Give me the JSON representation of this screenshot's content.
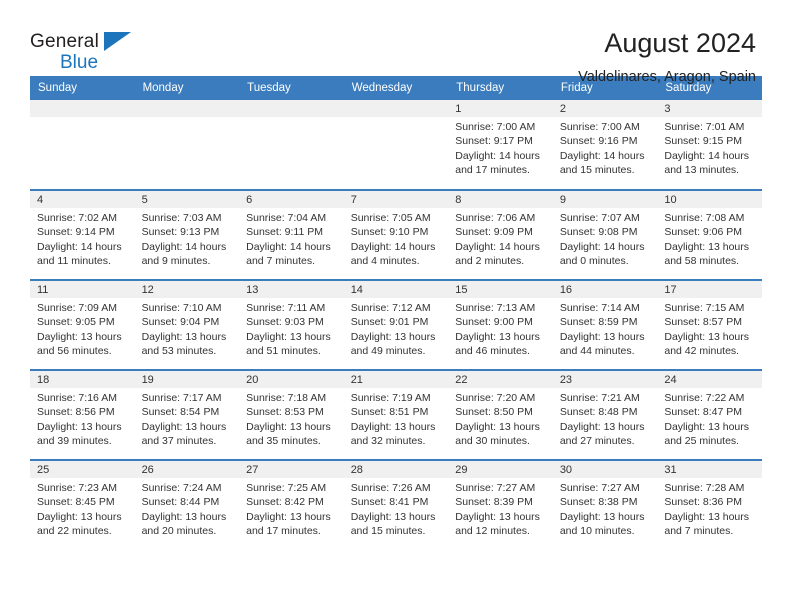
{
  "brand": {
    "name_line1": "General",
    "name_line2": "Blue",
    "accent_color": "#1c75bc"
  },
  "header": {
    "title": "August 2024",
    "location": "Valdelinares, Aragon, Spain",
    "header_bg": "#3a7cbd",
    "header_text_color": "#ffffff"
  },
  "weekday_headers": [
    "Sunday",
    "Monday",
    "Tuesday",
    "Wednesday",
    "Thursday",
    "Friday",
    "Saturday"
  ],
  "weeks": [
    [
      {
        "day": "",
        "sunrise": "",
        "sunset": "",
        "daylight_line1": "",
        "daylight_line2": ""
      },
      {
        "day": "",
        "sunrise": "",
        "sunset": "",
        "daylight_line1": "",
        "daylight_line2": ""
      },
      {
        "day": "",
        "sunrise": "",
        "sunset": "",
        "daylight_line1": "",
        "daylight_line2": ""
      },
      {
        "day": "",
        "sunrise": "",
        "sunset": "",
        "daylight_line1": "",
        "daylight_line2": ""
      },
      {
        "day": "1",
        "sunrise": "Sunrise: 7:00 AM",
        "sunset": "Sunset: 9:17 PM",
        "daylight_line1": "Daylight: 14 hours",
        "daylight_line2": "and 17 minutes."
      },
      {
        "day": "2",
        "sunrise": "Sunrise: 7:00 AM",
        "sunset": "Sunset: 9:16 PM",
        "daylight_line1": "Daylight: 14 hours",
        "daylight_line2": "and 15 minutes."
      },
      {
        "day": "3",
        "sunrise": "Sunrise: 7:01 AM",
        "sunset": "Sunset: 9:15 PM",
        "daylight_line1": "Daylight: 14 hours",
        "daylight_line2": "and 13 minutes."
      }
    ],
    [
      {
        "day": "4",
        "sunrise": "Sunrise: 7:02 AM",
        "sunset": "Sunset: 9:14 PM",
        "daylight_line1": "Daylight: 14 hours",
        "daylight_line2": "and 11 minutes."
      },
      {
        "day": "5",
        "sunrise": "Sunrise: 7:03 AM",
        "sunset": "Sunset: 9:13 PM",
        "daylight_line1": "Daylight: 14 hours",
        "daylight_line2": "and 9 minutes."
      },
      {
        "day": "6",
        "sunrise": "Sunrise: 7:04 AM",
        "sunset": "Sunset: 9:11 PM",
        "daylight_line1": "Daylight: 14 hours",
        "daylight_line2": "and 7 minutes."
      },
      {
        "day": "7",
        "sunrise": "Sunrise: 7:05 AM",
        "sunset": "Sunset: 9:10 PM",
        "daylight_line1": "Daylight: 14 hours",
        "daylight_line2": "and 4 minutes."
      },
      {
        "day": "8",
        "sunrise": "Sunrise: 7:06 AM",
        "sunset": "Sunset: 9:09 PM",
        "daylight_line1": "Daylight: 14 hours",
        "daylight_line2": "and 2 minutes."
      },
      {
        "day": "9",
        "sunrise": "Sunrise: 7:07 AM",
        "sunset": "Sunset: 9:08 PM",
        "daylight_line1": "Daylight: 14 hours",
        "daylight_line2": "and 0 minutes."
      },
      {
        "day": "10",
        "sunrise": "Sunrise: 7:08 AM",
        "sunset": "Sunset: 9:06 PM",
        "daylight_line1": "Daylight: 13 hours",
        "daylight_line2": "and 58 minutes."
      }
    ],
    [
      {
        "day": "11",
        "sunrise": "Sunrise: 7:09 AM",
        "sunset": "Sunset: 9:05 PM",
        "daylight_line1": "Daylight: 13 hours",
        "daylight_line2": "and 56 minutes."
      },
      {
        "day": "12",
        "sunrise": "Sunrise: 7:10 AM",
        "sunset": "Sunset: 9:04 PM",
        "daylight_line1": "Daylight: 13 hours",
        "daylight_line2": "and 53 minutes."
      },
      {
        "day": "13",
        "sunrise": "Sunrise: 7:11 AM",
        "sunset": "Sunset: 9:03 PM",
        "daylight_line1": "Daylight: 13 hours",
        "daylight_line2": "and 51 minutes."
      },
      {
        "day": "14",
        "sunrise": "Sunrise: 7:12 AM",
        "sunset": "Sunset: 9:01 PM",
        "daylight_line1": "Daylight: 13 hours",
        "daylight_line2": "and 49 minutes."
      },
      {
        "day": "15",
        "sunrise": "Sunrise: 7:13 AM",
        "sunset": "Sunset: 9:00 PM",
        "daylight_line1": "Daylight: 13 hours",
        "daylight_line2": "and 46 minutes."
      },
      {
        "day": "16",
        "sunrise": "Sunrise: 7:14 AM",
        "sunset": "Sunset: 8:59 PM",
        "daylight_line1": "Daylight: 13 hours",
        "daylight_line2": "and 44 minutes."
      },
      {
        "day": "17",
        "sunrise": "Sunrise: 7:15 AM",
        "sunset": "Sunset: 8:57 PM",
        "daylight_line1": "Daylight: 13 hours",
        "daylight_line2": "and 42 minutes."
      }
    ],
    [
      {
        "day": "18",
        "sunrise": "Sunrise: 7:16 AM",
        "sunset": "Sunset: 8:56 PM",
        "daylight_line1": "Daylight: 13 hours",
        "daylight_line2": "and 39 minutes."
      },
      {
        "day": "19",
        "sunrise": "Sunrise: 7:17 AM",
        "sunset": "Sunset: 8:54 PM",
        "daylight_line1": "Daylight: 13 hours",
        "daylight_line2": "and 37 minutes."
      },
      {
        "day": "20",
        "sunrise": "Sunrise: 7:18 AM",
        "sunset": "Sunset: 8:53 PM",
        "daylight_line1": "Daylight: 13 hours",
        "daylight_line2": "and 35 minutes."
      },
      {
        "day": "21",
        "sunrise": "Sunrise: 7:19 AM",
        "sunset": "Sunset: 8:51 PM",
        "daylight_line1": "Daylight: 13 hours",
        "daylight_line2": "and 32 minutes."
      },
      {
        "day": "22",
        "sunrise": "Sunrise: 7:20 AM",
        "sunset": "Sunset: 8:50 PM",
        "daylight_line1": "Daylight: 13 hours",
        "daylight_line2": "and 30 minutes."
      },
      {
        "day": "23",
        "sunrise": "Sunrise: 7:21 AM",
        "sunset": "Sunset: 8:48 PM",
        "daylight_line1": "Daylight: 13 hours",
        "daylight_line2": "and 27 minutes."
      },
      {
        "day": "24",
        "sunrise": "Sunrise: 7:22 AM",
        "sunset": "Sunset: 8:47 PM",
        "daylight_line1": "Daylight: 13 hours",
        "daylight_line2": "and 25 minutes."
      }
    ],
    [
      {
        "day": "25",
        "sunrise": "Sunrise: 7:23 AM",
        "sunset": "Sunset: 8:45 PM",
        "daylight_line1": "Daylight: 13 hours",
        "daylight_line2": "and 22 minutes."
      },
      {
        "day": "26",
        "sunrise": "Sunrise: 7:24 AM",
        "sunset": "Sunset: 8:44 PM",
        "daylight_line1": "Daylight: 13 hours",
        "daylight_line2": "and 20 minutes."
      },
      {
        "day": "27",
        "sunrise": "Sunrise: 7:25 AM",
        "sunset": "Sunset: 8:42 PM",
        "daylight_line1": "Daylight: 13 hours",
        "daylight_line2": "and 17 minutes."
      },
      {
        "day": "28",
        "sunrise": "Sunrise: 7:26 AM",
        "sunset": "Sunset: 8:41 PM",
        "daylight_line1": "Daylight: 13 hours",
        "daylight_line2": "and 15 minutes."
      },
      {
        "day": "29",
        "sunrise": "Sunrise: 7:27 AM",
        "sunset": "Sunset: 8:39 PM",
        "daylight_line1": "Daylight: 13 hours",
        "daylight_line2": "and 12 minutes."
      },
      {
        "day": "30",
        "sunrise": "Sunrise: 7:27 AM",
        "sunset": "Sunset: 8:38 PM",
        "daylight_line1": "Daylight: 13 hours",
        "daylight_line2": "and 10 minutes."
      },
      {
        "day": "31",
        "sunrise": "Sunrise: 7:28 AM",
        "sunset": "Sunset: 8:36 PM",
        "daylight_line1": "Daylight: 13 hours",
        "daylight_line2": "and 7 minutes."
      }
    ]
  ]
}
